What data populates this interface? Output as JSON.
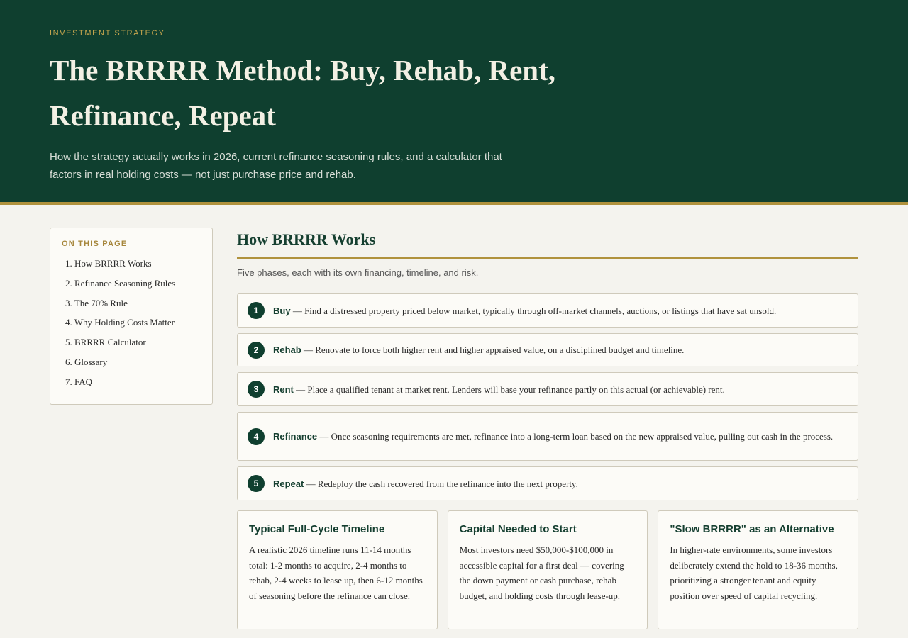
{
  "hero": {
    "eyebrow": "INVESTMENT STRATEGY",
    "title": "The BRRRR Method: Buy, Rehab, Rent, Refinance, Repeat",
    "subtitle": "How the strategy actually works in 2026, current refinance seasoning rules, and a calculator that factors in real holding costs — not just purchase price and rehab."
  },
  "toc": {
    "title": "ON THIS PAGE",
    "items": [
      "1. How BRRRR Works",
      "2. Refinance Seasoning Rules",
      "3. The 70% Rule",
      "4. Why Holding Costs Matter",
      "5. BRRRR Calculator",
      "6. Glossary",
      "7. FAQ"
    ]
  },
  "section": {
    "title": "How BRRRR Works",
    "lead": "Five phases, each with its own financing, timeline, and risk."
  },
  "steps": [
    {
      "num": "1",
      "term": "Buy",
      "text": " — Find a distressed property priced below market, typically through off-market channels, auctions, or listings that have sat unsold."
    },
    {
      "num": "2",
      "term": "Rehab",
      "text": " — Renovate to force both higher rent and higher appraised value, on a disciplined budget and timeline."
    },
    {
      "num": "3",
      "term": "Rent",
      "text": " — Place a qualified tenant at market rent. Lenders will base your refinance partly on this actual (or achievable) rent."
    },
    {
      "num": "4",
      "term": "Refinance",
      "text": " — Once seasoning requirements are met, refinance into a long-term loan based on the new appraised value, pulling out cash in the process."
    },
    {
      "num": "5",
      "term": "Repeat",
      "text": " — Redeploy the cash recovered from the refinance into the next property."
    }
  ],
  "cards": [
    {
      "title": "Typical Full-Cycle Timeline",
      "text": "A realistic 2026 timeline runs 11-14 months total: 1-2 months to acquire, 2-4 months to rehab, 2-4 weeks to lease up, then 6-12 months of seasoning before the refinance can close."
    },
    {
      "title": "Capital Needed to Start",
      "text": "Most investors need $50,000-$100,000 in accessible capital for a first deal — covering the down payment or cash purchase, rehab budget, and holding costs through lease-up."
    },
    {
      "title": "\"Slow BRRRR\" as an Alternative",
      "text": "In higher-rate environments, some investors deliberately extend the hold to 18-36 months, prioritizing a stronger tenant and equity position over speed of capital recycling."
    }
  ]
}
